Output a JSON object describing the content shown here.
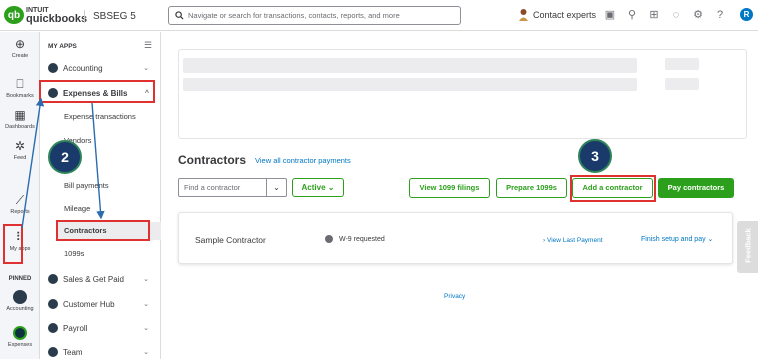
{
  "topbar": {
    "logo_intuit": "INTUIT",
    "logo_name": "quickbooks",
    "logo_mark": "qb",
    "company": "SBSEG 5",
    "search_placeholder": "Navigate or search for transactions, contacts, reports, and more",
    "contact": "Contact experts",
    "avatar_letter": "R"
  },
  "rail": {
    "create": "Create",
    "bookmarks": "Bookmarks",
    "dashboards": "Dashboards",
    "feed": "Feed",
    "reports": "Reports",
    "myapps": "My apps",
    "pinned": "PINNED",
    "accounting": "Accounting",
    "expenses": "Expenses"
  },
  "sidebar": {
    "heading": "MY APPS",
    "items": [
      {
        "label": "Accounting"
      },
      {
        "label": "Expenses & Bills"
      },
      {
        "label": "Sales & Get Paid"
      },
      {
        "label": "Customer Hub"
      },
      {
        "label": "Payroll"
      },
      {
        "label": "Team"
      }
    ],
    "sub_items": [
      {
        "label": "Expense transactions"
      },
      {
        "label": "Vendors"
      },
      {
        "label": "Bill payments"
      },
      {
        "label": "Mileage"
      },
      {
        "label": "Contractors"
      },
      {
        "label": "1099s"
      }
    ]
  },
  "main": {
    "title": "Contractors",
    "view_all_link": "View all contractor payments",
    "find_placeholder": "Find a contractor",
    "status_filter": "Active",
    "btn_view_1099": "View 1099 filings",
    "btn_prepare_1099": "Prepare 1099s",
    "btn_add_contractor": "Add a contractor",
    "btn_pay_contractors": "Pay contractors",
    "contractor": {
      "name": "Sample Contractor",
      "w9_status": "W-9 requested",
      "last_payment_link": "View Last Payment",
      "finish_setup": "Finish setup and pay"
    },
    "privacy": "Privacy"
  },
  "feedback": "Feedback",
  "annotations": {
    "step2": "2",
    "step3": "3",
    "highlight_color": "#e03131",
    "badge_color": "#1a3a6b"
  },
  "colors": {
    "brand_green": "#2ca01c",
    "link_blue": "#0077c5"
  }
}
